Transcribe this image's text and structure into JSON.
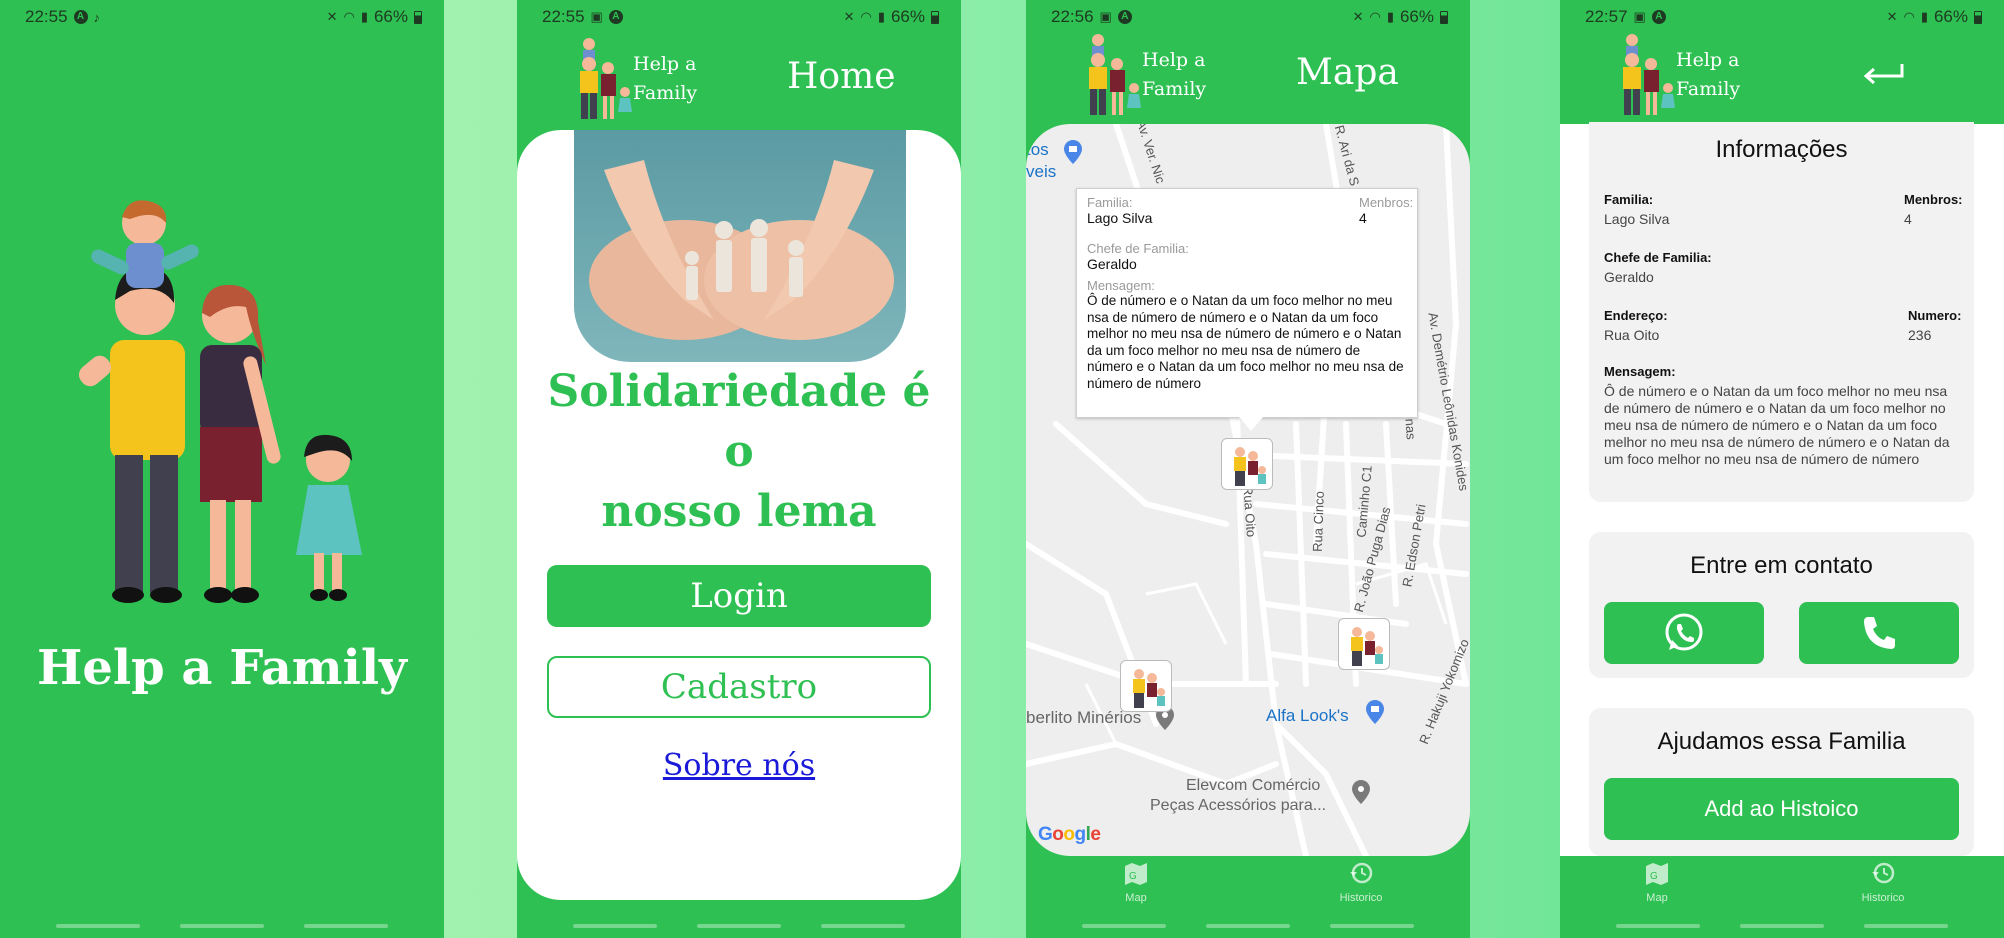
{
  "status_bars": [
    {
      "time": "22:55",
      "battery": "66%"
    },
    {
      "time": "22:55",
      "battery": "66%"
    },
    {
      "time": "22:56",
      "battery": "66%"
    },
    {
      "time": "22:57",
      "battery": "66%"
    }
  ],
  "splash": {
    "title": "Help a Family"
  },
  "header": {
    "logo_line1": "Help a",
    "logo_line2": "Family"
  },
  "home": {
    "title": "Home",
    "slogan_line1": "Solidariedade é o",
    "slogan_line2": "nosso lema",
    "login_label": "Login",
    "register_label": "Cadastro",
    "about_link": "Sobre nós"
  },
  "map_screen": {
    "title": "Mapa",
    "popup": {
      "familia_label": "Familia:",
      "familia_value": "Lago Silva",
      "membros_label": "Menbros:",
      "membros_value": "4",
      "chefe_label": "Chefe de Familia:",
      "chefe_value": "Geraldo",
      "mensagem_label": "Mensagem:",
      "mensagem_value": "Ô de número e o Natan da um foco melhor no meu nsa de número de número e o Natan da um foco melhor no meu nsa de número de número e o Natan da um foco melhor no meu nsa de número de número e o Natan da um foco melhor no meu nsa de número de número"
    },
    "streets": [
      "Av. Ver. Nic",
      "R. Ari da S",
      "Rua Oito",
      "Rua Cinco",
      "Caminho C1",
      "R. João Puga Dias",
      "R. Edson Petri",
      "R. Hakuji Yokomizo",
      "Av. Demétrio Leônidas Konides",
      "Ulinas"
    ],
    "places": {
      "partial_top": "tos",
      "partial_bottom": "veis",
      "minerios": "berlito Minérios",
      "alfa": "Alfa Look's",
      "elevcom_1": "Elevcom Comércio",
      "elevcom_2": "Peças Acessórios para..."
    },
    "google": "Google",
    "nav": {
      "map": "Map",
      "history": "Historico"
    }
  },
  "details": {
    "info_title": "Informações",
    "familia_label": "Familia:",
    "familia_value": "Lago Silva",
    "membros_label": "Menbros:",
    "membros_value": "4",
    "chefe_label": "Chefe de Familia:",
    "chefe_value": "Geraldo",
    "endereco_label": "Endereço:",
    "endereco_value": "Rua Oito",
    "numero_label": "Numero:",
    "numero_value": "236",
    "mensagem_label": "Mensagem:",
    "mensagem_value": "Ô de número e o Natan da um foco melhor no meu nsa de número de número e o Natan da um foco melhor no meu nsa de número de número e o Natan da um foco melhor no meu nsa de número de número e o Natan da um foco melhor no meu nsa de número de número",
    "contact_title": "Entre em contato",
    "helped_title": "Ajudamos essa Familia",
    "add_button": "Add ao Histoico",
    "nav": {
      "map": "Map",
      "history": "Historico"
    }
  },
  "colors": {
    "primary_green": "#2ec052",
    "link_blue": "#1a1ad8"
  }
}
